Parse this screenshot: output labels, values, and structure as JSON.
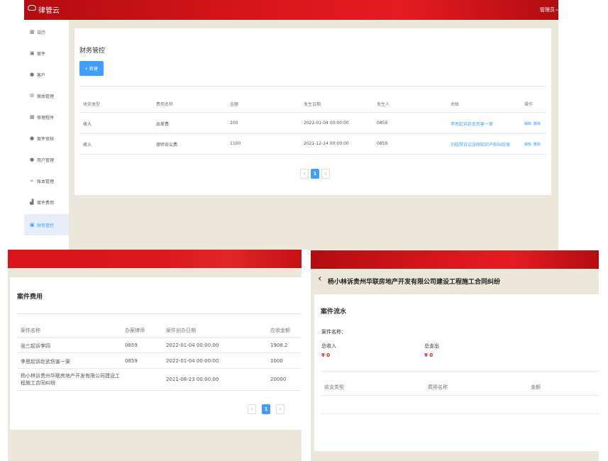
{
  "app": {
    "logo": "律管云",
    "user_menu": "管理员"
  },
  "sidebar": {
    "items": [
      {
        "label": "日历",
        "icon": "grid-icon"
      },
      {
        "label": "案件",
        "icon": "lock-icon"
      },
      {
        "label": "客户",
        "icon": "user-icon"
      },
      {
        "label": "案由管理",
        "icon": "gear-icon"
      },
      {
        "label": "审理程序",
        "icon": "grid-icon"
      },
      {
        "label": "案件审核",
        "icon": "user-icon"
      },
      {
        "label": "用户管理",
        "icon": "user-icon"
      },
      {
        "label": "账本管理",
        "icon": "link-icon"
      },
      {
        "label": "案件费用",
        "icon": "chart-icon"
      },
      {
        "label": "财务管控",
        "icon": "lock-icon"
      }
    ],
    "active_index": 9
  },
  "finance": {
    "title": "财务管控",
    "new_button": "+ 新建",
    "columns": [
      "收支类型",
      "费用名称",
      "金额",
      "发生日期",
      "发生人",
      "关联",
      "操作"
    ],
    "rows": [
      {
        "type": "收入",
        "name": "出差费",
        "amount": "200",
        "date": "2022-01-04 00:00:00",
        "person": "0859",
        "link": "李思起诉赵武伤害一案",
        "edit": "编辑",
        "delete": "删除"
      },
      {
        "type": "收入",
        "name": "律师诉讼费",
        "amount": "1100",
        "date": "2021-12-14 00:00:00",
        "person": "0859",
        "link": "刘晓琴诉讼张刚知识产权纠纷案",
        "edit": "编辑",
        "delete": "删除"
      }
    ],
    "pagination": {
      "prev": "‹",
      "current": "1",
      "next": "›"
    }
  },
  "case_fees": {
    "title": "案件费用",
    "columns": [
      "案件名称",
      "办案律师",
      "案件创办日期",
      "应收金额"
    ],
    "rows": [
      {
        "name": "张三起诉李四",
        "lawyer": "0859",
        "date": "2022-01-04 00:00:00",
        "amount": "1908.2"
      },
      {
        "name": "李思起诉赵武伤害一案",
        "lawyer": "0859",
        "date": "2022-01-04 00:00:00",
        "amount": "1000"
      },
      {
        "name_line1": "杨小林诉贵州华联房地产开发有限公司建设工",
        "name_line2": "程施工合同纠纷",
        "lawyer": "",
        "date": "2021-08-23 00:00:00",
        "amount": "20000"
      }
    ],
    "pagination": {
      "prev": "‹",
      "current": "1",
      "next": "›"
    }
  },
  "case_flow": {
    "back": "‹",
    "header_title": "杨小林诉贵州华联房地产开发有限公司建设工程施工合同纠纷",
    "section_title": "案件流水",
    "case_name_label": "案件名称：",
    "income_label": "总收入",
    "income_value": "¥ 0",
    "expense_label": "总支出",
    "expense_value": "¥ 0",
    "columns": [
      "收支类型",
      "费用名称",
      "金额"
    ]
  },
  "colors": {
    "red": "#d8161b",
    "blue": "#409eff",
    "tan": "#ece7db",
    "value_red": "#e02020"
  }
}
